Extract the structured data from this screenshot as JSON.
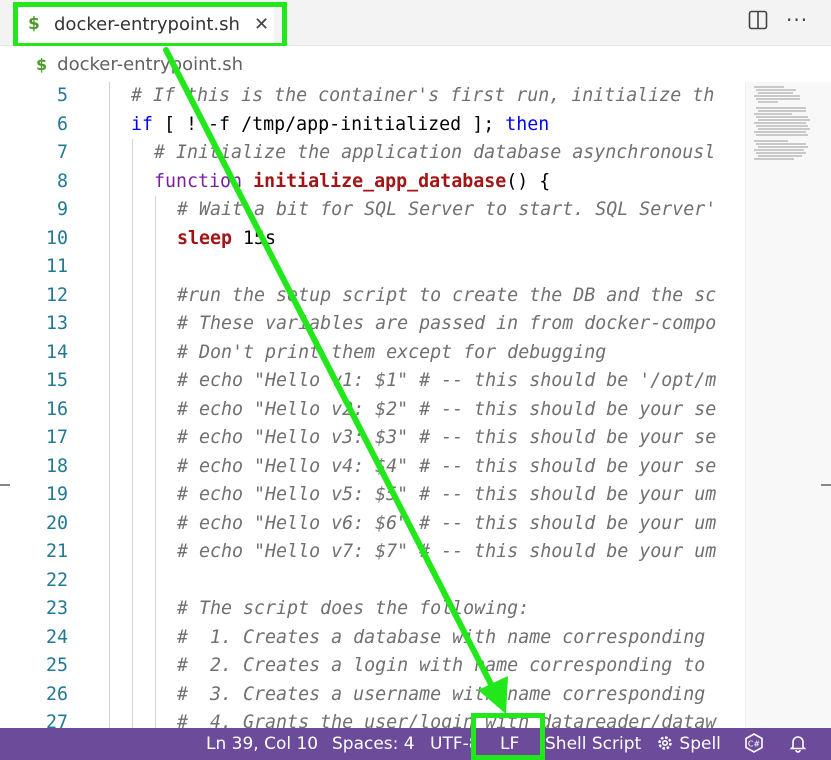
{
  "tab": {
    "icon": "$",
    "label": "docker-entrypoint.sh"
  },
  "breadcrumb": {
    "icon": "$",
    "label": "docker-entrypoint.sh"
  },
  "editor": {
    "lines": [
      {
        "n": "5",
        "indent": 0,
        "parts": [
          {
            "t": "# If this is the container's first run, initialize th",
            "c": "c-comment"
          }
        ]
      },
      {
        "n": "6",
        "indent": 0,
        "parts": [
          {
            "t": "if",
            "c": "c-kw"
          },
          {
            "t": " [ ! -f /tmp/app-initialized ]; ",
            "c": ""
          },
          {
            "t": "then",
            "c": "c-kw"
          }
        ]
      },
      {
        "n": "7",
        "indent": 1,
        "parts": [
          {
            "t": "# Initialize the application database asynchronousl",
            "c": "c-comment"
          }
        ]
      },
      {
        "n": "8",
        "indent": 1,
        "parts": [
          {
            "t": "function",
            "c": "c-purple"
          },
          {
            "t": " ",
            "c": ""
          },
          {
            "t": "initialize_app_database",
            "c": "c-fn"
          },
          {
            "t": "() {",
            "c": ""
          }
        ]
      },
      {
        "n": "9",
        "indent": 2,
        "parts": [
          {
            "t": "# Wait a bit for SQL Server to start. SQL Server'",
            "c": "c-comment"
          }
        ]
      },
      {
        "n": "10",
        "indent": 2,
        "parts": [
          {
            "t": "sleep",
            "c": "c-fn"
          },
          {
            "t": " 15s",
            "c": ""
          }
        ]
      },
      {
        "n": "11",
        "indent": 2,
        "parts": []
      },
      {
        "n": "12",
        "indent": 2,
        "parts": [
          {
            "t": "#run the setup script to create the DB and the sc",
            "c": "c-comment"
          }
        ]
      },
      {
        "n": "13",
        "indent": 2,
        "parts": [
          {
            "t": "# These variables are passed in from docker-compo",
            "c": "c-comment"
          }
        ]
      },
      {
        "n": "14",
        "indent": 2,
        "parts": [
          {
            "t": "# Don't print them except for debugging",
            "c": "c-comment"
          }
        ]
      },
      {
        "n": "15",
        "indent": 2,
        "parts": [
          {
            "t": "# echo \"Hello v1: $1\" # -- this should be '/opt/m",
            "c": "c-comment"
          }
        ]
      },
      {
        "n": "16",
        "indent": 2,
        "parts": [
          {
            "t": "# echo \"Hello v2: $2\" # -- this should be your se",
            "c": "c-comment"
          }
        ]
      },
      {
        "n": "17",
        "indent": 2,
        "parts": [
          {
            "t": "# echo \"Hello v3: $3\" # -- this should be your se",
            "c": "c-comment"
          }
        ]
      },
      {
        "n": "18",
        "indent": 2,
        "parts": [
          {
            "t": "# echo \"Hello v4: $4\" # -- this should be your se",
            "c": "c-comment"
          }
        ]
      },
      {
        "n": "19",
        "indent": 2,
        "parts": [
          {
            "t": "# echo \"Hello v5: $5\" # -- this should be your um",
            "c": "c-comment"
          }
        ]
      },
      {
        "n": "20",
        "indent": 2,
        "parts": [
          {
            "t": "# echo \"Hello v6: $6\" # -- this should be your um",
            "c": "c-comment"
          }
        ]
      },
      {
        "n": "21",
        "indent": 2,
        "parts": [
          {
            "t": "# echo \"Hello v7: $7\" # -- this should be your um",
            "c": "c-comment"
          }
        ]
      },
      {
        "n": "22",
        "indent": 2,
        "parts": []
      },
      {
        "n": "23",
        "indent": 2,
        "parts": [
          {
            "t": "# The script does the following:",
            "c": "c-comment"
          }
        ]
      },
      {
        "n": "24",
        "indent": 2,
        "parts": [
          {
            "t": "#  1. Creates a database with name corresponding",
            "c": "c-comment"
          }
        ]
      },
      {
        "n": "25",
        "indent": 2,
        "parts": [
          {
            "t": "#  2. Creates a login with name corresponding to",
            "c": "c-comment"
          }
        ]
      },
      {
        "n": "26",
        "indent": 2,
        "parts": [
          {
            "t": "#  3. Creates a username with name corresponding",
            "c": "c-comment"
          }
        ]
      },
      {
        "n": "27",
        "indent": 2,
        "parts": [
          {
            "t": "#  4. Grants the user/login with datareader/dataw",
            "c": "c-comment"
          }
        ]
      }
    ]
  },
  "statusbar": {
    "position": "Ln 39, Col 10",
    "spaces": "Spaces: 4",
    "encoding": "UTF-8",
    "eol": "LF",
    "language": "Shell Script",
    "spell": "Spell"
  },
  "colors": {
    "statusbar": "#6c4b9a",
    "highlight": "#22e81b"
  }
}
